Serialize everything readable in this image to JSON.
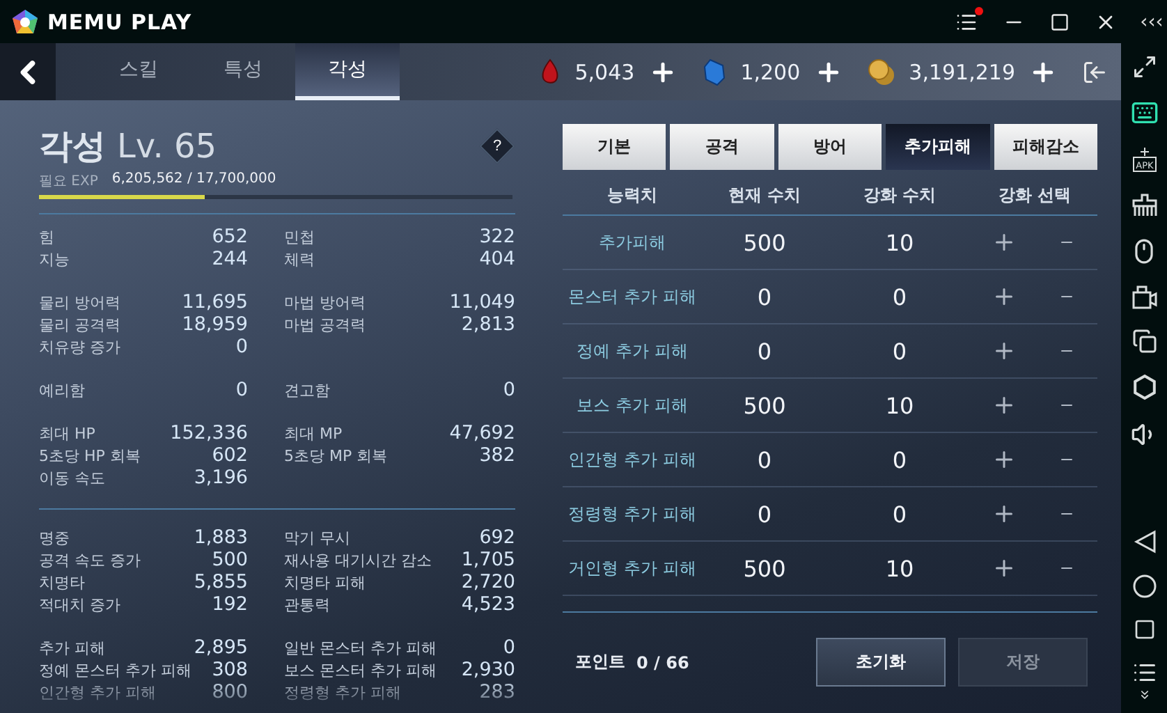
{
  "window": {
    "title": "MEMU PLAY",
    "collapse": "‹‹‹"
  },
  "tabs": [
    {
      "label": "스킬",
      "selected": false
    },
    {
      "label": "특성",
      "selected": false
    },
    {
      "label": "각성",
      "selected": true
    }
  ],
  "currencies": [
    {
      "kind": "ruby",
      "amount": "5,043"
    },
    {
      "kind": "crystal",
      "amount": "1,200"
    },
    {
      "kind": "gold",
      "amount": "3,191,219"
    }
  ],
  "awakening": {
    "title": "각성",
    "level": "Lv. 65",
    "help": "?",
    "exp_label": "필요 EXP",
    "exp_value": "6,205,562 / 17,700,000",
    "level_progress": {
      "level": 0.35
    }
  },
  "stat_sections": [
    {
      "groups": [
        {
          "rows": [
            {
              "left": {
                "label": "힘",
                "value": "652"
              },
              "right": {
                "label": "민첩",
                "value": "322"
              }
            },
            {
              "left": {
                "label": "지능",
                "value": "244"
              },
              "right": {
                "label": "체력",
                "value": "404"
              }
            }
          ]
        },
        {
          "rows": [
            {
              "left": {
                "label": "물리 방어력",
                "value": "11,695"
              },
              "right": {
                "label": "마법 방어력",
                "value": "11,049"
              }
            },
            {
              "left": {
                "label": "물리 공격력",
                "value": "18,959"
              },
              "right": {
                "label": "마법 공격력",
                "value": "2,813"
              }
            },
            {
              "left": {
                "label": "치유량 증가",
                "value": "0"
              }
            }
          ]
        },
        {
          "rows": [
            {
              "left": {
                "label": "예리함",
                "value": "0"
              },
              "right": {
                "label": "견고함",
                "value": "0"
              }
            }
          ]
        },
        {
          "rows": [
            {
              "left": {
                "label": "최대 HP",
                "value": "152,336"
              },
              "right": {
                "label": "최대 MP",
                "value": "47,692"
              }
            },
            {
              "left": {
                "label": "5초당 HP 회복",
                "value": "602"
              },
              "right": {
                "label": "5초당 MP 회복",
                "value": "382"
              }
            },
            {
              "left": {
                "label": "이동 속도",
                "value": "3,196"
              }
            }
          ]
        }
      ]
    },
    {
      "groups": [
        {
          "rows": [
            {
              "left": {
                "label": "명중",
                "value": "1,883"
              },
              "right": {
                "label": "막기 무시",
                "value": "692"
              }
            },
            {
              "left": {
                "label": "공격 속도 증가",
                "value": "500"
              },
              "right": {
                "label": "재사용 대기시간 감소",
                "value": "1,705"
              }
            },
            {
              "left": {
                "label": "치명타",
                "value": "5,855"
              },
              "right": {
                "label": "치명타 피해",
                "value": "2,720"
              }
            },
            {
              "left": {
                "label": "적대치 증가",
                "value": "192"
              },
              "right": {
                "label": "관통력",
                "value": "4,523"
              }
            }
          ]
        },
        {
          "rows": [
            {
              "left": {
                "label": "추가 피해",
                "value": "2,895"
              },
              "right": {
                "label": "일반 몬스터 추가 피해",
                "value": "0"
              }
            },
            {
              "left": {
                "label": "정예 몬스터 추가 피해",
                "value": "308"
              },
              "right": {
                "label": "보스 몬스터 추가 피해",
                "value": "2,930"
              }
            },
            {
              "left": {
                "label": "인간형 추가 피해",
                "value": "800"
              },
              "right": {
                "label": "정령형 추가 피해",
                "value": "283"
              }
            }
          ]
        }
      ]
    }
  ],
  "category_tabs": [
    {
      "label": "기본",
      "selected": false
    },
    {
      "label": "공격",
      "selected": false
    },
    {
      "label": "방어",
      "selected": false
    },
    {
      "label": "추가피해",
      "selected": true
    },
    {
      "label": "피해감소",
      "selected": false
    }
  ],
  "table": {
    "columns": [
      "능력치",
      "현재 수치",
      "강화 수치",
      "강화 선택"
    ],
    "rows": [
      {
        "name": "추가피해",
        "current": "500",
        "enhance": "10"
      },
      {
        "name": "몬스터 추가 피해",
        "current": "0",
        "enhance": "0"
      },
      {
        "name": "정예 추가 피해",
        "current": "0",
        "enhance": "0"
      },
      {
        "name": "보스 추가 피해",
        "current": "500",
        "enhance": "10"
      },
      {
        "name": "인간형 추가 피해",
        "current": "0",
        "enhance": "0"
      },
      {
        "name": "정령형 추가 피해",
        "current": "0",
        "enhance": "0"
      },
      {
        "name": "거인형 추가 피해",
        "current": "500",
        "enhance": "10"
      }
    ]
  },
  "footer": {
    "points_label": "포인트",
    "points_value": "0 / 66",
    "buttons": [
      {
        "label": "초기화",
        "disabled": false
      },
      {
        "label": "저장",
        "disabled": true
      }
    ]
  },
  "sidebar": {
    "apk_label": "APK"
  }
}
